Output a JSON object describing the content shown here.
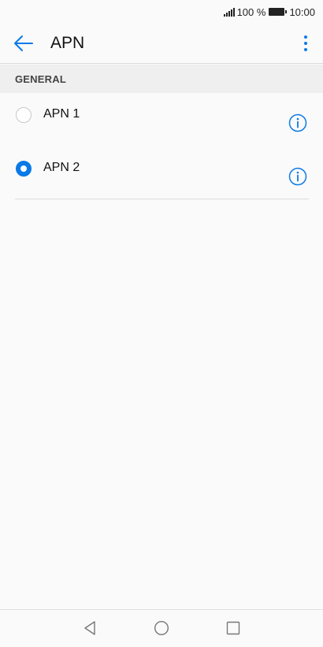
{
  "status_bar": {
    "battery": "100 %",
    "time": "10:00"
  },
  "app_bar": {
    "title": "APN",
    "back_icon": "arrow-left-icon",
    "menu_icon": "more-vertical-icon"
  },
  "section": {
    "title": "GENERAL"
  },
  "apn_list": [
    {
      "label": "APN 1",
      "selected": false
    },
    {
      "label": "APN 2",
      "selected": true
    }
  ],
  "nav_bar": {
    "icons": [
      "back-triangle-icon",
      "home-circle-icon",
      "recents-square-icon"
    ]
  },
  "colors": {
    "accent": "#0a7ae6",
    "background": "#fafafa",
    "section_bg": "#efefef"
  }
}
